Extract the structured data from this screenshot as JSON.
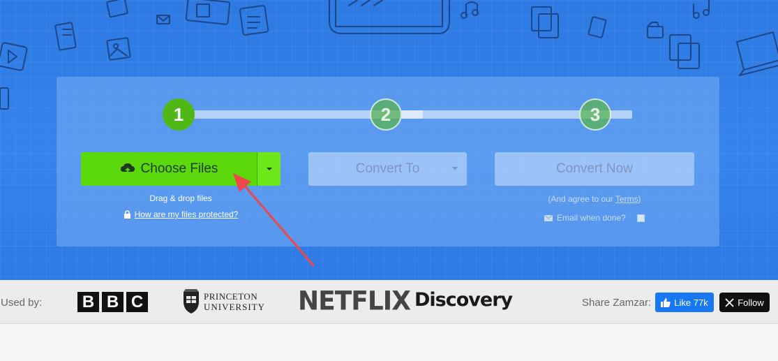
{
  "steps": {
    "step1": "1",
    "step2": "2",
    "step3": "3"
  },
  "upload": {
    "choose_label": "Choose Files",
    "drag_drop_text": "Drag & drop files",
    "protected_link": "How are my files protected?"
  },
  "convert": {
    "convert_to_label": "Convert To",
    "convert_now_label": "Convert Now",
    "agree_prefix": "(And agree to our ",
    "terms_link": "Terms",
    "agree_suffix": ")",
    "email_label": "Email when done?"
  },
  "used_by": {
    "label": "Used by:",
    "logos": {
      "bbc": [
        "B",
        "B",
        "C"
      ],
      "princeton_line1": "PRINCETON",
      "princeton_line2": "UNIVERSITY",
      "netflix": "NETFLIX",
      "discovery": "Discovery"
    }
  },
  "share": {
    "label": "Share Zamzar:",
    "like_label": "Like 77k",
    "follow_label": "Follow"
  },
  "colors": {
    "hero_blue": "#2f7be4",
    "primary_green": "#5bd90c",
    "step_green": "#4fb817",
    "facebook_blue": "#1877f2",
    "arrow_red": "#f0474a"
  }
}
